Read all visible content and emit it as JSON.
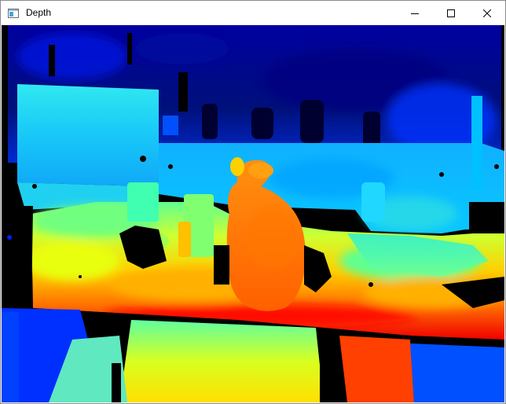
{
  "window": {
    "title": "Depth",
    "app_icon": "window-app-icon",
    "controls": {
      "minimize_icon": "minimize-icon",
      "maximize_icon": "maximize-icon",
      "close_icon": "close-icon"
    }
  },
  "colormap": "jet",
  "colors": {
    "background": "#000000",
    "far": "#00008f",
    "mid": "#10e8e8",
    "near": "#ff2000"
  }
}
